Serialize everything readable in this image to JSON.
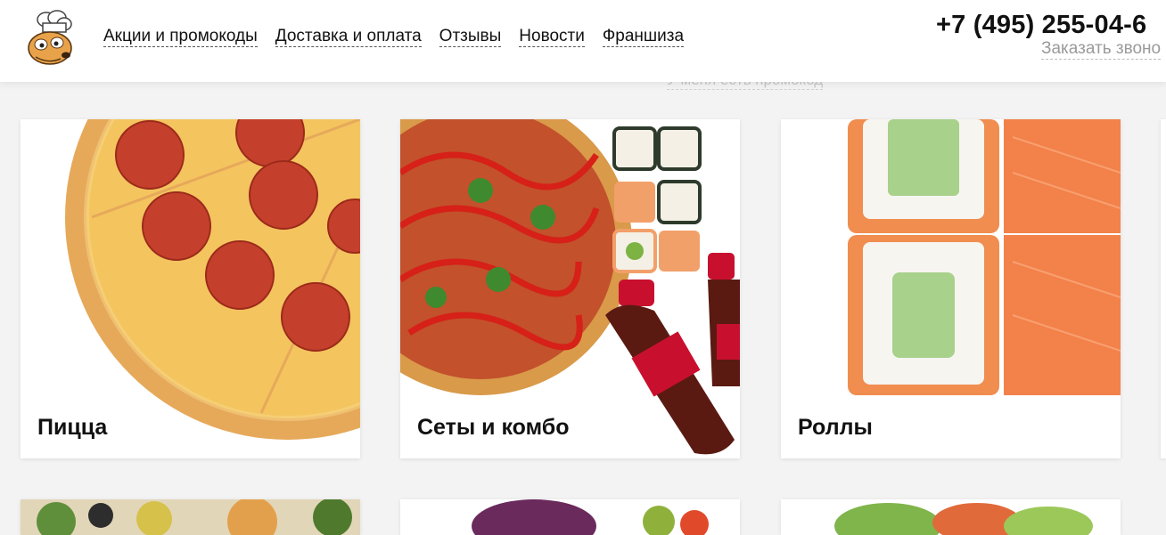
{
  "header": {
    "nav": [
      {
        "label": "Акции и промокоды"
      },
      {
        "label": "Доставка и оплата"
      },
      {
        "label": "Отзывы"
      },
      {
        "label": "Новости"
      },
      {
        "label": "Франшиза"
      }
    ],
    "phone": "+7 (495) 255-04-6",
    "callback": "Заказать звоно",
    "promo_hint": "У меня есть промокод"
  },
  "categories": [
    {
      "title": "Пицца",
      "image": "pepperoni-pizza"
    },
    {
      "title": "Сеты и комбо",
      "image": "pizza-rolls-cola-combo"
    },
    {
      "title": "Роллы",
      "image": "salmon-rolls"
    }
  ],
  "colors": {
    "text": "#111111",
    "muted": "#9a9a9a",
    "background": "#f3f3f3",
    "card": "#ffffff"
  }
}
